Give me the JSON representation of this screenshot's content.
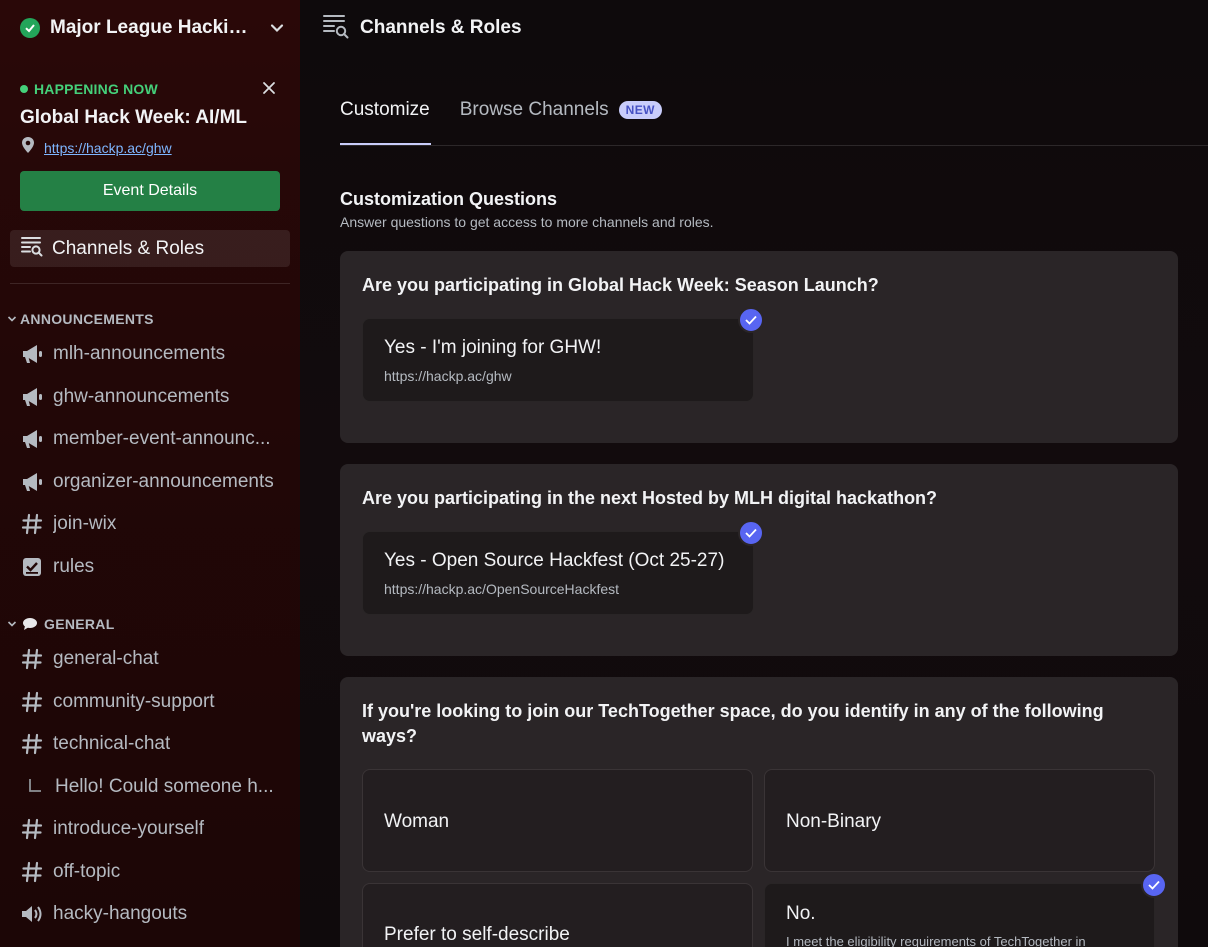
{
  "server": {
    "name": "Major League Hackin...",
    "verified_icon": "verified-check-icon",
    "menu_icon": "chevron-down-icon"
  },
  "event": {
    "status": "HAPPENING NOW",
    "title": "Global Hack Week: AI/ML",
    "link": "https://hackp.ac/ghw",
    "button_label": "Event Details",
    "status_color": "#45d07a",
    "button_color": "#248045"
  },
  "nav": {
    "channels_roles_label": "Channels & Roles"
  },
  "categories": [
    {
      "label": "ANNOUNCEMENTS",
      "channels": [
        {
          "name": "mlh-announcements",
          "icon": "megaphone-icon"
        },
        {
          "name": "ghw-announcements",
          "icon": "megaphone-icon"
        },
        {
          "name": "member-event-announc...",
          "icon": "megaphone-icon"
        },
        {
          "name": "organizer-announcements",
          "icon": "megaphone-icon"
        },
        {
          "name": "join-wix",
          "icon": "hash-icon"
        },
        {
          "name": "rules",
          "icon": "rules-checkbox-icon"
        }
      ]
    },
    {
      "label": "GENERAL",
      "emoji": "speech-bubble-icon",
      "channels": [
        {
          "name": "general-chat",
          "icon": "hash-icon"
        },
        {
          "name": "community-support",
          "icon": "hash-icon"
        },
        {
          "name": "technical-chat",
          "icon": "hash-icon"
        },
        {
          "name": "Hello! Could someone h...",
          "icon": "thread-branch-icon"
        },
        {
          "name": "introduce-yourself",
          "icon": "hash-icon"
        },
        {
          "name": "off-topic",
          "icon": "hash-icon"
        },
        {
          "name": "hacky-hangouts",
          "icon": "speaker-icon"
        }
      ]
    }
  ],
  "main": {
    "title": "Channels & Roles",
    "tabs": [
      {
        "label": "Customize",
        "active": true
      },
      {
        "label": "Browse Channels",
        "badge": "NEW",
        "active": false
      }
    ],
    "section_title": "Customization Questions",
    "section_subtitle": "Answer questions to get access to more channels and roles.",
    "accent_color": "#5865f2",
    "questions": [
      {
        "text": "Are you participating in Global Hack Week: Season Launch?",
        "options": [
          {
            "title": "Yes - I'm joining for GHW!",
            "desc": "https://hackp.ac/ghw",
            "selected": true
          }
        ]
      },
      {
        "text": "Are you participating in the next Hosted by MLH digital hackathon?",
        "options": [
          {
            "title": "Yes - Open Source Hackfest (Oct 25-27)",
            "desc": "https://hackp.ac/OpenSourceHackfest",
            "selected": true
          }
        ]
      },
      {
        "text": "If you're looking to join our TechTogether space, do you identify in any of the following ways?",
        "options": [
          {
            "title": "Woman",
            "selected": false
          },
          {
            "title": "Non-Binary",
            "selected": false
          },
          {
            "title": "Prefer to self-describe",
            "selected": false
          },
          {
            "title": "No.",
            "desc": "I meet the eligibility requirements of TechTogether in",
            "selected": true
          }
        ]
      }
    ]
  }
}
